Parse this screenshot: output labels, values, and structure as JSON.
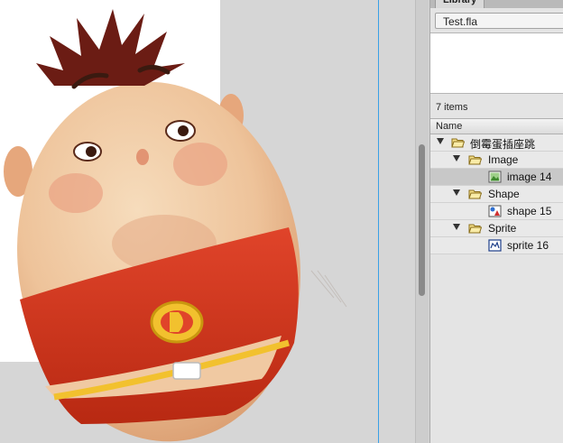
{
  "library": {
    "tab_label": "Library",
    "document": "Test.fla",
    "item_count": "7 items",
    "column_name": "Name",
    "items": [
      {
        "label": "倒霉蛋插座跳",
        "type": "folder",
        "expanded": true
      },
      {
        "label": "Image",
        "type": "folder",
        "expanded": true
      },
      {
        "label": "image 14",
        "type": "bitmap",
        "selected": true
      },
      {
        "label": "Shape",
        "type": "folder",
        "expanded": true
      },
      {
        "label": "shape 15",
        "type": "graphic"
      },
      {
        "label": "Sprite",
        "type": "folder",
        "expanded": true
      },
      {
        "label": "sprite 16",
        "type": "movieclip"
      }
    ]
  },
  "icons": {
    "folder": "open-folder-icon",
    "bitmap": "bitmap-icon",
    "graphic": "graphic-symbol-icon",
    "movieclip": "movieclip-symbol-icon"
  },
  "colors": {
    "stage_bg": "#d6d6d6",
    "selection_guide": "#3aa0e6",
    "belt": "#d93a1c",
    "logo": "#f2c12e"
  }
}
